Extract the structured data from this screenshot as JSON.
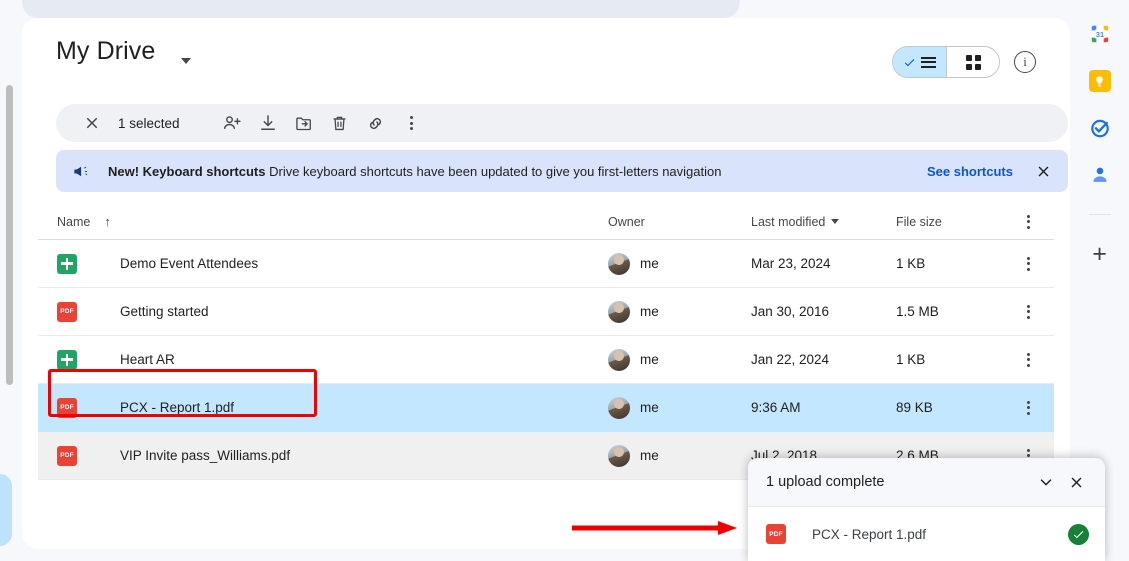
{
  "header": {
    "title": "My Drive",
    "title_caret": "dropdown-caret",
    "view_list_label": "list-view",
    "view_grid_label": "grid-view",
    "info_label": "i"
  },
  "selection_toolbar": {
    "close_label": "close-selection",
    "count_text": "1 selected",
    "actions": [
      {
        "name": "share-add-person",
        "label": "Share"
      },
      {
        "name": "download",
        "label": "Download"
      },
      {
        "name": "move-to-folder",
        "label": "Move"
      },
      {
        "name": "delete-trash",
        "label": "Remove"
      },
      {
        "name": "get-link",
        "label": "Get link"
      },
      {
        "name": "more-actions",
        "label": "More actions"
      }
    ]
  },
  "banner": {
    "icon": "campaign-megaphone-icon",
    "title": "New! Keyboard shortcuts",
    "message": "Drive keyboard shortcuts have been updated to give you first-letters navigation",
    "link": "See shortcuts",
    "close": "close-banner"
  },
  "table": {
    "columns": {
      "name": "Name",
      "sort_arrow": "↑",
      "owner": "Owner",
      "modified": "Last modified",
      "size": "File size"
    },
    "rows": [
      {
        "icon": "sheets",
        "icon_label": "",
        "name": "Demo Event Attendees",
        "owner": "me",
        "modified": "Mar 23, 2024",
        "size": "1 KB",
        "state": "normal"
      },
      {
        "icon": "pdf",
        "icon_label": "PDF",
        "name": "Getting started",
        "owner": "me",
        "modified": "Jan 30, 2016",
        "size": "1.5 MB",
        "state": "normal"
      },
      {
        "icon": "sheets",
        "icon_label": "",
        "name": "Heart AR",
        "owner": "me",
        "modified": "Jan 22, 2024",
        "size": "1 KB",
        "state": "normal"
      },
      {
        "icon": "pdf",
        "icon_label": "PDF",
        "name": "PCX - Report 1.pdf",
        "owner": "me",
        "modified": "9:36 AM",
        "size": "89 KB",
        "state": "selected"
      },
      {
        "icon": "pdf",
        "icon_label": "PDF",
        "name": "VIP Invite pass_Williams.pdf",
        "owner": "me",
        "modified": "Jul 2, 2018",
        "size": "2.6 MB",
        "state": "hovered"
      }
    ]
  },
  "upload_toast": {
    "title": "1 upload complete",
    "collapse": "chevron-down",
    "close": "close-toast",
    "file": {
      "icon_label": "PDF",
      "name": "PCX - Report 1.pdf",
      "status": "complete"
    }
  },
  "side_panel": {
    "items": [
      {
        "name": "google-calendar-icon",
        "label": "31"
      },
      {
        "name": "google-keep-icon",
        "label": ""
      },
      {
        "name": "google-tasks-icon",
        "label": ""
      },
      {
        "name": "google-contacts-icon",
        "label": ""
      }
    ],
    "add_label": "+"
  },
  "annotations": {
    "highlight_box_target": "PCX - Report 1.pdf",
    "arrow_color": "#ee0000",
    "box_color": "#ee0000"
  },
  "colors": {
    "selected_row": "#c2e7ff",
    "hover_row": "#f0f0f0",
    "banner_bg": "#d9e3fb",
    "link": "#0b57d0",
    "pdf": "#ea4335",
    "sheets": "#21a464",
    "success": "#188038"
  }
}
